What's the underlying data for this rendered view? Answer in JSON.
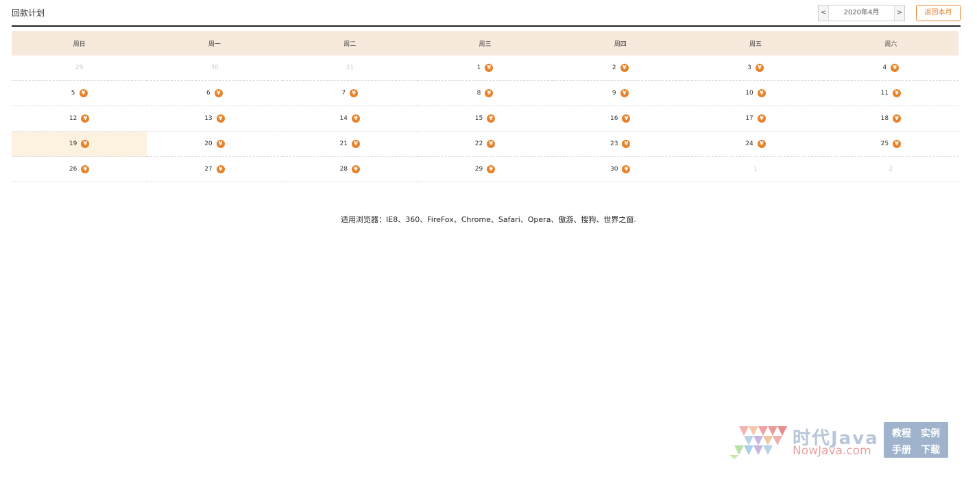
{
  "header": {
    "title": "回款计划",
    "prev_label": "<",
    "month_label": "2020年4月",
    "next_label": ">",
    "back_label": "返回本月"
  },
  "weekdays": [
    "周日",
    "周一",
    "周二",
    "周三",
    "周四",
    "周五",
    "周六"
  ],
  "weeks": [
    [
      {
        "d": "29",
        "other": true
      },
      {
        "d": "30",
        "other": true
      },
      {
        "d": "31",
        "other": true
      },
      {
        "d": "1",
        "yen": true
      },
      {
        "d": "2",
        "yen": true
      },
      {
        "d": "3",
        "yen": true
      },
      {
        "d": "4",
        "yen": true
      }
    ],
    [
      {
        "d": "5",
        "yen": true
      },
      {
        "d": "6",
        "yen": true
      },
      {
        "d": "7",
        "yen": true
      },
      {
        "d": "8",
        "yen": true
      },
      {
        "d": "9",
        "yen": true
      },
      {
        "d": "10",
        "yen": true
      },
      {
        "d": "11",
        "yen": true
      }
    ],
    [
      {
        "d": "12",
        "yen": true
      },
      {
        "d": "13",
        "yen": true
      },
      {
        "d": "14",
        "yen": true
      },
      {
        "d": "15",
        "yen": true
      },
      {
        "d": "16",
        "yen": true
      },
      {
        "d": "17",
        "yen": true
      },
      {
        "d": "18",
        "yen": true
      }
    ],
    [
      {
        "d": "19",
        "yen": true,
        "today": true
      },
      {
        "d": "20",
        "yen": true
      },
      {
        "d": "21",
        "yen": true
      },
      {
        "d": "22",
        "yen": true
      },
      {
        "d": "23",
        "yen": true
      },
      {
        "d": "24",
        "yen": true
      },
      {
        "d": "25",
        "yen": true
      }
    ],
    [
      {
        "d": "26",
        "yen": true
      },
      {
        "d": "27",
        "yen": true
      },
      {
        "d": "28",
        "yen": true
      },
      {
        "d": "29",
        "yen": true
      },
      {
        "d": "30",
        "yen": true
      },
      {
        "d": "1",
        "other": true
      },
      {
        "d": "2",
        "other": true
      }
    ]
  ],
  "yen_symbol": "¥",
  "footer": "适用浏览器：IE8、360、FireFox、Chrome、Safari、Opera、傲游、搜狗、世界之窗.",
  "watermark": {
    "cn": "时代Java",
    "en": "NowJava.com",
    "links": [
      "教程",
      "实例",
      "手册",
      "下载"
    ]
  },
  "colors": {
    "accent": "#e8822a",
    "header_bg": "#f8e9dd",
    "today_bg": "#fdf1e0"
  }
}
